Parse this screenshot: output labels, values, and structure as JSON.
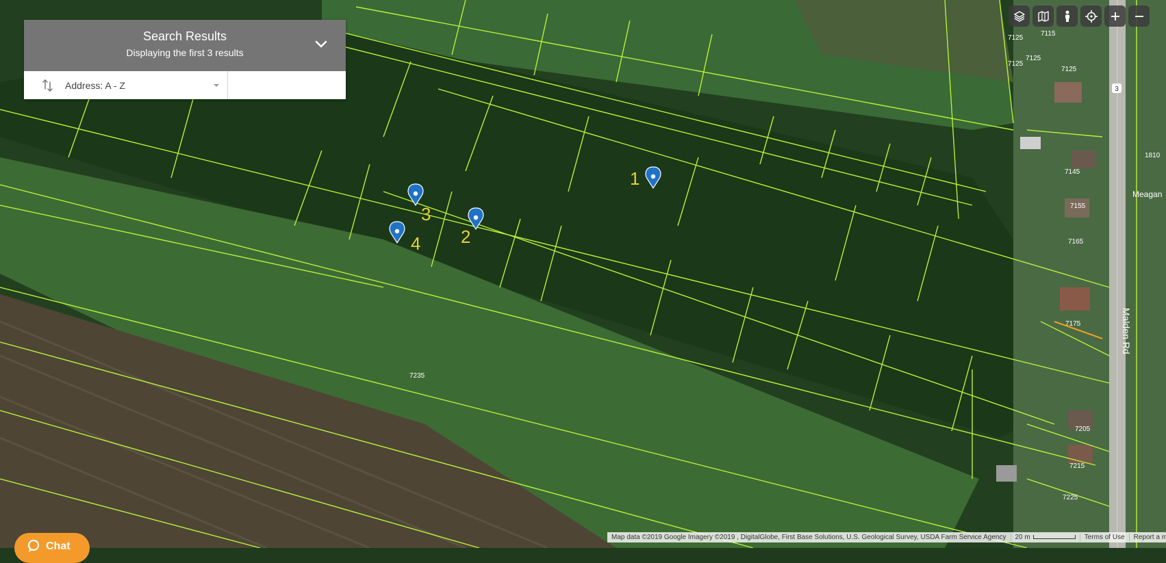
{
  "panel": {
    "title": "Search Results",
    "subtitle": "Displaying the first 3 results",
    "collapse_icon": "chevron-down-icon",
    "sort_icon": "sort-arrows-icon",
    "sort_value": "Address: A - Z"
  },
  "controls": [
    {
      "name": "layers-button",
      "icon": "layers-icon"
    },
    {
      "name": "map-type-button",
      "icon": "map-icon"
    },
    {
      "name": "street-view-button",
      "icon": "pegman-icon"
    },
    {
      "name": "locate-button",
      "icon": "crosshair-icon"
    },
    {
      "name": "zoom-in-button",
      "icon": "plus-icon"
    },
    {
      "name": "zoom-out-button",
      "icon": "minus-icon"
    }
  ],
  "markers": [
    {
      "label": "1"
    },
    {
      "label": "2"
    },
    {
      "label": "3"
    },
    {
      "label": "4"
    }
  ],
  "parcel_labels": [
    "7115",
    "7125",
    "7125",
    "7125",
    "7125",
    "7145",
    "7155",
    "7165",
    "7175",
    "7205",
    "7215",
    "7225",
    "7235",
    "1810"
  ],
  "road": {
    "name": "Malden Rd",
    "side_street": "Meagan",
    "route_shield": "3"
  },
  "attribution": {
    "map_data": "Map data ©2019 Google Imagery ©2019 , DigitalGlobe, First Base Solutions, U.S. Geological Survey, USDA Farm Service Agency",
    "scale": "20 m",
    "terms": "Terms of Use",
    "report": "Report a map error"
  },
  "chat": {
    "label": "Chat",
    "icon": "chat-bubble-icon",
    "color": "#f39a2b"
  },
  "colors": {
    "parcel_line": "#b8f23a",
    "marker": "#1f73c7",
    "marker_label": "#e6d13a"
  }
}
